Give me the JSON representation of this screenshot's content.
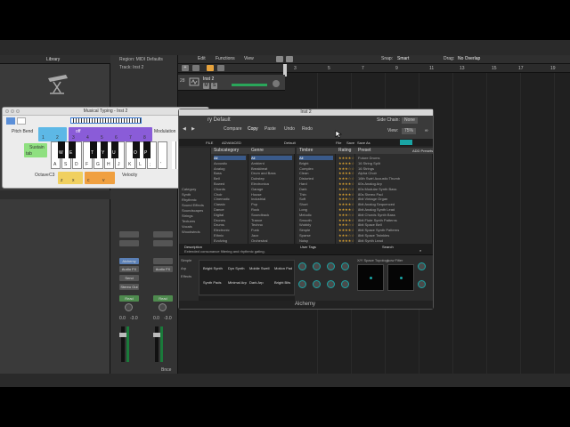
{
  "library": {
    "title": "Library"
  },
  "inspector": {
    "region": "Region: MIDI Defaults",
    "track": "Track: Inst 2",
    "plugin_slot": "Alchemy",
    "slot2": "Audio FX",
    "slot3": "Audio FX",
    "send": "Send",
    "stereo_out": "Stereo Out",
    "read1": "Read",
    "read2": "Read",
    "vol1": "0.0",
    "pan1": "-3.0",
    "vol2": "0.0",
    "pan2": "-3.0",
    "inst_name": "Inst 2",
    "bounce": "Bnce"
  },
  "toolbar": {
    "edit": "Edit",
    "functions": "Functions",
    "view": "View",
    "snap_label": "Snap:",
    "snap_value": "Smart",
    "drag_label": "Drag:",
    "drag_value": "No Overlap"
  },
  "ruler": [
    "3",
    "5",
    "7",
    "9",
    "11",
    "13",
    "15",
    "17",
    "19"
  ],
  "track": {
    "number": "28",
    "name": "Inst 2",
    "m": "M",
    "s": "S"
  },
  "typing": {
    "title": "Musical Typing - Inst 2",
    "pitch_bend": "Pitch Bend",
    "modulation": "Modulation",
    "sustain": "Sustain",
    "tab": "tab",
    "octave": "Octave",
    "velocity": "Velocity",
    "octave_keys": [
      "z",
      "x"
    ],
    "velocity_keys": [
      "c",
      "v"
    ],
    "octave_num": "C3",
    "white_keys": [
      "A",
      "S",
      "D",
      "F",
      "G",
      "H",
      "J",
      "K",
      "L",
      ";",
      "'"
    ],
    "black_keys": [
      "W",
      "E",
      "T",
      "Y",
      "U",
      "O",
      "P"
    ],
    "pitch_keys": [
      "1",
      "2"
    ],
    "mod_keys": [
      "3",
      "4",
      "5",
      "6",
      "7",
      "8"
    ],
    "off": "off"
  },
  "plugin": {
    "title": "Inst 2",
    "preset": "ry Default",
    "compare": "Compare",
    "copy": "Copy",
    "paste": "Paste",
    "undo": "Undo",
    "redo": "Redo",
    "side_chain": "Side Chain:",
    "side_chain_value": "None",
    "view": "View:",
    "view_value": "75%",
    "bar_items": [
      "FILE",
      "ADVANCED",
      "Default",
      "File",
      "Save",
      "Save As"
    ],
    "columns": [
      {
        "name": "Subcategory",
        "items": [
          "All",
          "Acoustic",
          "Analog",
          "Bass",
          "Bell",
          "Bowed",
          "Chords",
          "Choir",
          "Cinematic",
          "Classic",
          "Dance",
          "Digital",
          "Drones",
          "Drums",
          "Electronic",
          "Ethnic",
          "Evolving"
        ]
      },
      {
        "name": "Genre",
        "items": [
          "All",
          "Ambient",
          "Breakbeat",
          "Drum and Bass",
          "Dubstep",
          "Electronica",
          "Garage",
          "House",
          "Industrial",
          "Pop",
          "Rock",
          "Soundtrack",
          "Trance",
          "Techno",
          "Funk",
          "Jazz",
          "Orchestral"
        ]
      },
      {
        "name": "Timbre",
        "items": [
          "All",
          "Bright",
          "Complex",
          "Clean",
          "Distorted",
          "Hard",
          "Dark",
          "Thin",
          "Soft",
          "Short",
          "Long",
          "Melodic",
          "Smooth",
          "Wobbly",
          "Simple",
          "Sparse",
          "Noisy"
        ]
      },
      {
        "name": "Rating",
        "items": [
          "★★★★☆",
          "★★★★☆",
          "★★★☆☆",
          "★★★★☆",
          "★★★☆☆",
          "★★★★☆",
          "★★★☆☆",
          "★★★★☆",
          "★★★☆☆",
          "★★★★☆",
          "★★★★☆",
          "★★★☆☆",
          "★★★★☆",
          "★★★☆☆",
          "★★★★☆",
          "★★★☆☆",
          "★★★★☆"
        ]
      },
      {
        "name": "Preset",
        "items": [
          "Future Drums",
          "16 String Split",
          "16 Strings",
          "Alpha Choir",
          "16th Swirl Acoustic Thumb",
          "60s Analog Arp",
          "60s Modular Synth Bass",
          "80s Stereo Pad",
          "8bit Vintage Organ",
          "8bit Analog Sequenced",
          "8bit Analog Synth Lead",
          "8bit Chords Synth Bass",
          "8bit Flute Synth Patterns",
          "8bit Space Bell",
          "8bit Space Synth Patterns",
          "8bit Space Twinkles",
          "8bit Synth Lead"
        ]
      }
    ],
    "categories": [
      "Category",
      "Synth",
      "Rhythmic",
      "Sound Effects",
      "Soundscapes",
      "Strings",
      "Textures",
      "Vocals",
      "Woodwinds"
    ],
    "add_presets": "ADD Presets",
    "description_title": "Description",
    "description": "Extended consonance filtering and rhythmic gating.",
    "user_tags": "User Tags",
    "edit": "Edit",
    "search": "Search",
    "perf_labels": [
      "Bright Synth",
      "Dyn Synth",
      "Mobile Swell",
      "Motion Pad",
      "Synth Pads",
      "Minimal Arp",
      "Dark Arp",
      "Bright Bits"
    ],
    "perf_side": [
      "Simple",
      "Arp",
      "Effects"
    ],
    "knob_labels": [
      "Cutoff",
      "Resonance",
      "Filter Mod",
      "Bandwidth",
      "Drive",
      "Bright",
      "Gain",
      "Detune",
      "Volume",
      "Reverb"
    ],
    "xy1": "X/Y Space Topology",
    "xy2": "Low Filter",
    "footer": "Alchemy"
  },
  "colors": {
    "pad_blue": "#5db8e6",
    "pad_purple": "#8a5cd8",
    "pad_green": "#8fe080",
    "pad_yellow": "#f0d060",
    "pad_orange": "#f0a040",
    "teal": "#1aa5a5",
    "dark_strip": "#333333"
  }
}
